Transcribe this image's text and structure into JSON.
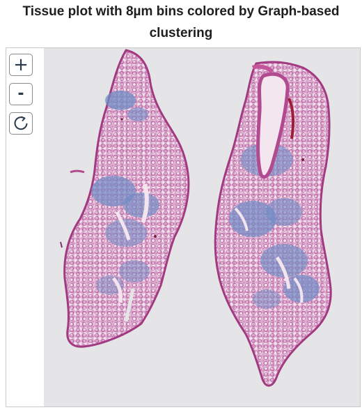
{
  "title": "Tissue plot with 8µm bins colored by Graph-based clustering",
  "controls": {
    "zoom_in": "+",
    "zoom_out": "-",
    "reset_icon": "rotate-cw-icon"
  },
  "colors": {
    "tissue_pink": "#b24a90",
    "tissue_light": "#dcaad0",
    "tissue_blue": "#6f8cc4",
    "background": "#e5e4e6"
  }
}
